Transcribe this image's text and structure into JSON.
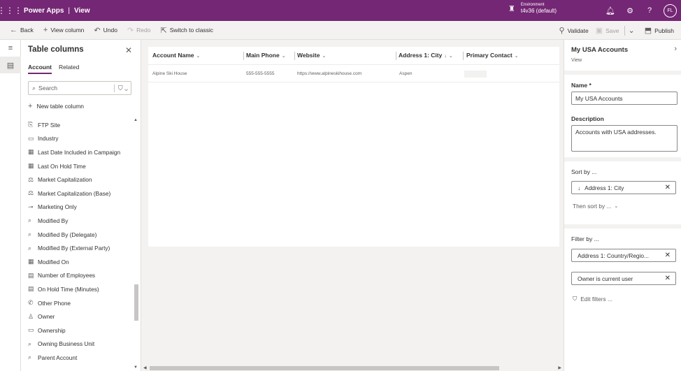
{
  "titlebar": {
    "app_name": "Power Apps",
    "separator": "|",
    "page": "View",
    "environment_label": "Environment",
    "environment_name": "t4v36 (default)",
    "avatar_initials": "FL",
    "icons": [
      "waffle-icon",
      "environment-icon",
      "bell-icon",
      "gear-icon",
      "help-icon"
    ]
  },
  "commandbar": {
    "back": "Back",
    "view_column": "View column",
    "undo": "Undo",
    "redo": "Redo",
    "switch_classic": "Switch to classic",
    "validate": "Validate",
    "save": "Save",
    "publish": "Publish"
  },
  "columns_pane": {
    "title": "Table columns",
    "tabs": [
      "Account",
      "Related"
    ],
    "search_placeholder": "Search",
    "new_column": "New table column",
    "items": [
      {
        "icon": "⎘",
        "label": "FTP Site"
      },
      {
        "icon": "▭",
        "label": "Industry"
      },
      {
        "icon": "▦",
        "label": "Last Date Included in Campaign"
      },
      {
        "icon": "▦",
        "label": "Last On Hold Time"
      },
      {
        "icon": "⚖",
        "label": "Market Capitalization"
      },
      {
        "icon": "⚖",
        "label": "Market Capitalization (Base)"
      },
      {
        "icon": "⊸",
        "label": "Marketing Only"
      },
      {
        "icon": "⌕",
        "label": "Modified By"
      },
      {
        "icon": "⌕",
        "label": "Modified By (Delegate)"
      },
      {
        "icon": "⌕",
        "label": "Modified By (External Party)"
      },
      {
        "icon": "▦",
        "label": "Modified On"
      },
      {
        "icon": "▤",
        "label": "Number of Employees"
      },
      {
        "icon": "▤",
        "label": "On Hold Time (Minutes)"
      },
      {
        "icon": "✆",
        "label": "Other Phone"
      },
      {
        "icon": "♙",
        "label": "Owner"
      },
      {
        "icon": "▭",
        "label": "Ownership"
      },
      {
        "icon": "⌕",
        "label": "Owning Business Unit"
      },
      {
        "icon": "⌕",
        "label": "Parent Account"
      }
    ]
  },
  "grid": {
    "columns": [
      {
        "label": "Account Name"
      },
      {
        "label": "Main Phone"
      },
      {
        "label": "Website"
      },
      {
        "label": "Address 1: City",
        "sort": "↓"
      },
      {
        "label": "Primary Contact"
      }
    ],
    "rows": [
      {
        "account_name": "Alpine Ski House",
        "main_phone": "555-555-5555",
        "website": "https://www.alpineskihouse.com",
        "city": "Aspen",
        "primary_contact": ""
      }
    ]
  },
  "properties": {
    "title": "My USA Accounts",
    "subtitle": "View",
    "name_label": "Name *",
    "name_value": "My USA Accounts",
    "description_label": "Description",
    "description_value": "Accounts with USA addresses.",
    "sort_label": "Sort by ...",
    "sort_value": "Address 1: City",
    "then_sort": "Then sort by ...",
    "filter_label": "Filter by ...",
    "filters": [
      "Address 1: Country/Regio...",
      "Owner is current user"
    ],
    "edit_filters": "Edit filters ..."
  }
}
